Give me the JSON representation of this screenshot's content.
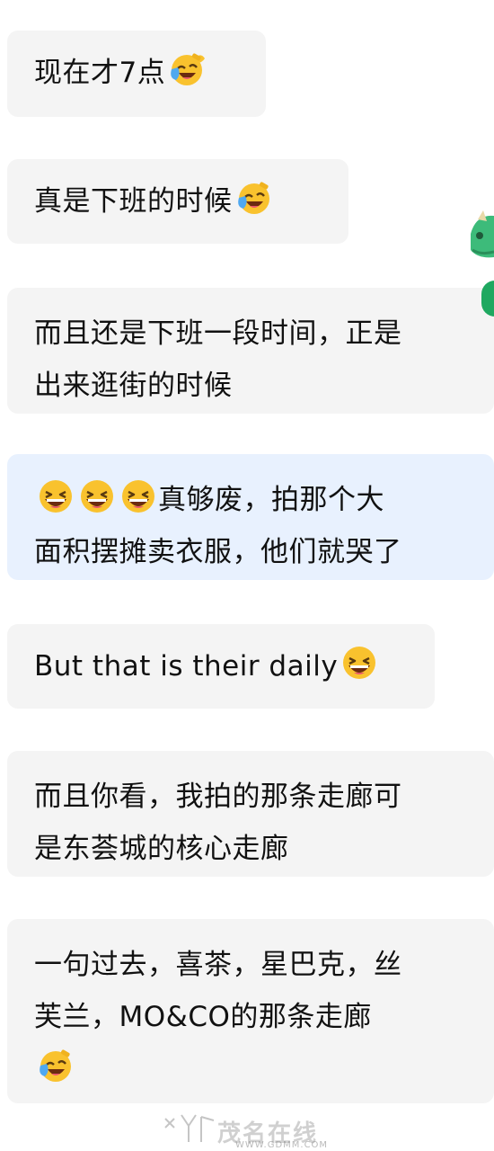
{
  "messages": [
    {
      "id": "b1",
      "lines": [
        "现在才7点"
      ],
      "emoji_after": "laugh-tears-emoji"
    },
    {
      "id": "b2",
      "lines": [
        "真是下班的时候"
      ],
      "emoji_after": "laugh-tears-emoji"
    },
    {
      "id": "b3",
      "lines": [
        "而且还是下班一段时间，正是",
        "出来逛街的时候"
      ]
    },
    {
      "id": "b4",
      "emoji_before": [
        "grin-emoji",
        "grin-emoji",
        "grin-emoji"
      ],
      "lines": [
        "真够废，拍那个大",
        "面积摆摊卖衣服，他们就哭了"
      ],
      "highlighted": true
    },
    {
      "id": "b5",
      "lines": [
        "But that is their daily"
      ],
      "emoji_after": "grin-emoji"
    },
    {
      "id": "b6",
      "lines": [
        "而且你看，我拍的那条走廊可",
        "是东荟城的核心走廊"
      ]
    },
    {
      "id": "b7",
      "lines": [
        "一句过去，喜茶，星巴克，丝",
        "芙兰，MO&CO的那条走廊"
      ],
      "emoji_line": "laugh-tears-emoji"
    }
  ],
  "watermark": {
    "text": "茂名在线",
    "url": "WWW.GDMM.COM"
  },
  "colors": {
    "bubble": "#f4f4f4",
    "bubble_highlight": "#e8f1fe",
    "text": "#111111",
    "side_green": "#1fa860"
  }
}
